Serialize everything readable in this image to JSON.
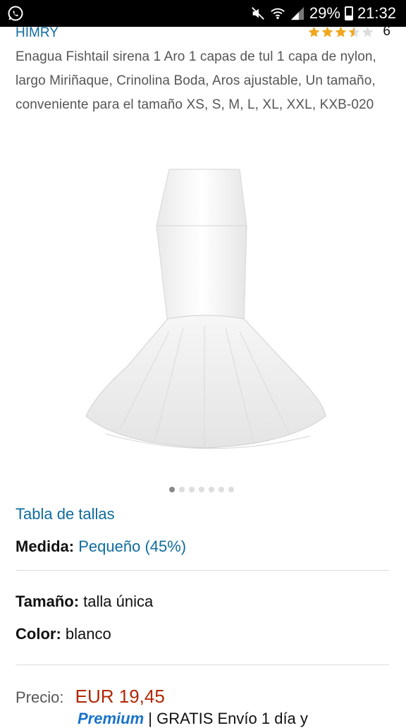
{
  "status_bar": {
    "battery": "29%",
    "time": "21:32"
  },
  "product": {
    "brand": "HIMRY",
    "rating_value": 3.5,
    "rating_count": "6",
    "title": "Enagua Fishtail sirena 1 Aro 1 capas de tul 1 capa de nylon, largo Miriñaque, Crinolina Boda, Aros ajustable, Un tamaño, conveniente para el tamaño XS, S, M, L, XL, XXL, KXB-020"
  },
  "gallery": {
    "image_count": 7,
    "active_index": 0
  },
  "size_chart_link": "Tabla de tallas",
  "medida": {
    "label": "Medida:",
    "value": "Pequeño (45%)"
  },
  "tamano": {
    "label": "Tamaño:",
    "value": "talla única"
  },
  "color": {
    "label": "Color:",
    "value": "blanco"
  },
  "price": {
    "label": "Precio:",
    "value": "EUR 19,45"
  },
  "shipping": {
    "premium": "Premium",
    "text": "| GRATIS Envío 1 día y"
  },
  "colors": {
    "link": "#0f6c9e",
    "price": "#b12704",
    "star": "#f0a61d"
  }
}
